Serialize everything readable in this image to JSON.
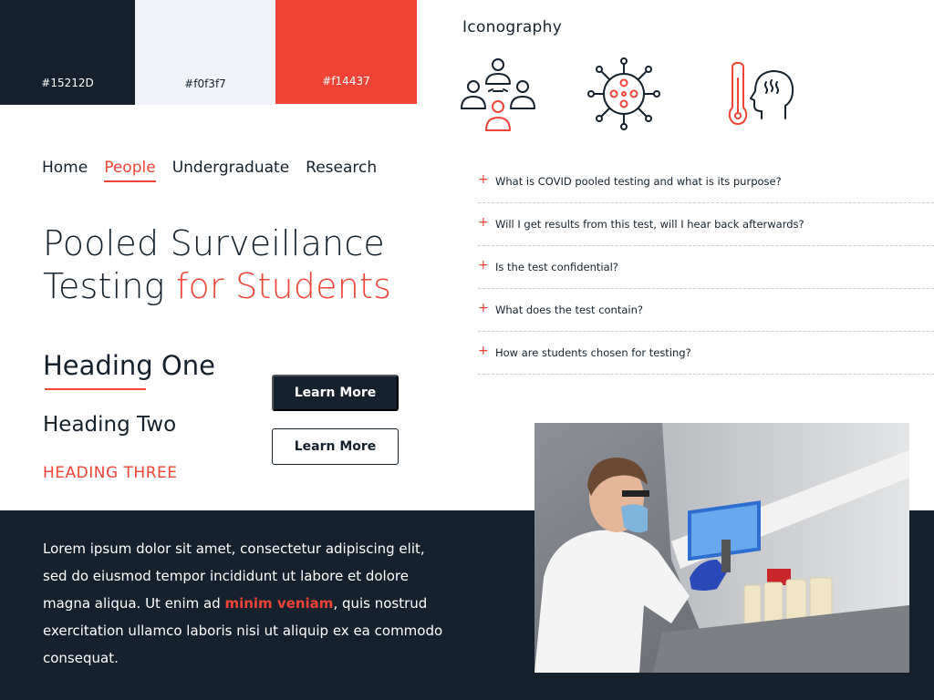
{
  "swatches": [
    {
      "label": "#15212D",
      "color": "#15212D"
    },
    {
      "label": "#f0f3f7",
      "color": "#f0f3f7"
    },
    {
      "label": "#f14437",
      "color": "#f14437"
    }
  ],
  "iconography": {
    "title": "Iconography",
    "icons": [
      "people-group-icon",
      "virus-icon",
      "thermometer-head-icon"
    ]
  },
  "nav": {
    "items": [
      {
        "label": "Home",
        "active": false
      },
      {
        "label": "People",
        "active": true
      },
      {
        "label": "Undergraduate",
        "active": false
      },
      {
        "label": "Research",
        "active": false
      }
    ]
  },
  "hero": {
    "title_line1": "Pooled Surveillance",
    "title_line2_main": "Testing ",
    "title_line2_accent": "for Students"
  },
  "headings": {
    "one": "Heading One",
    "two": "Heading Two",
    "three": "HEADING THREE"
  },
  "buttons": {
    "primary": "Learn More",
    "secondary": "Learn More"
  },
  "faq": {
    "items": [
      "What is COVID pooled testing and what is its purpose?",
      "Will I get results from this test, will I hear back afterwards?",
      "Is the test confidential?",
      "What does the test contain?",
      "How are students chosen for testing?"
    ]
  },
  "body": {
    "text_before": "Lorem ipsum dolor sit amet, consectetur adipiscing elit, sed do eiusmod tempor incididunt ut labore et dolore magna aliqua. Ut enim ad ",
    "highlight": "minim veniam",
    "text_after": ", quis nostrud exercitation ullamco laboris nisi ut aliquip ex ea commodo consequat."
  },
  "colors": {
    "dark": "#15212D",
    "light": "#f0f3f7",
    "accent": "#f14437"
  }
}
